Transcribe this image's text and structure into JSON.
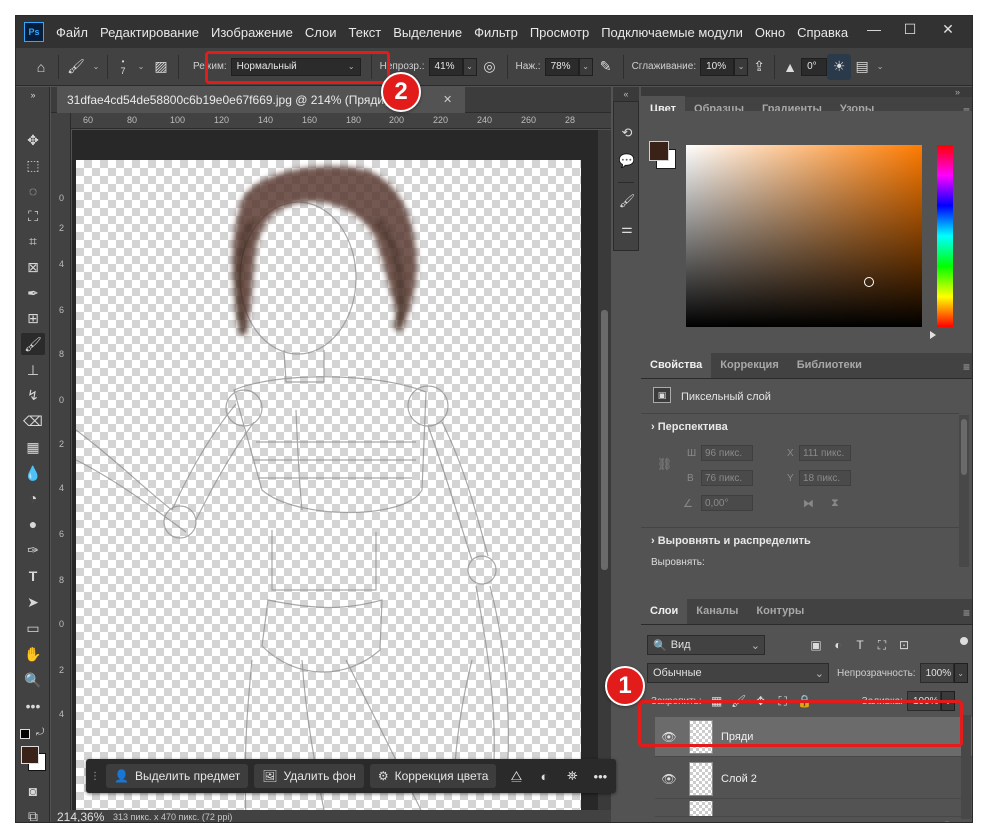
{
  "app": {
    "logo": "Ps"
  },
  "menu": [
    "Файл",
    "Редактирование",
    "Изображение",
    "Слои",
    "Текст",
    "Выделение",
    "Фильтр",
    "Просмотр",
    "Подключаемые модули",
    "Окно",
    "Справка"
  ],
  "window_controls": {
    "minimize": "—",
    "maximize": "☐",
    "close": "✕"
  },
  "options_bar": {
    "brush_size": "7",
    "mode_label": "Режим:",
    "mode_value": "Нормальный",
    "opacity_label": "Непрозр.:",
    "opacity_value": "41%",
    "pressure_label": "Наж.:",
    "pressure_value": "78%",
    "smoothing_label": "Сглаживание:",
    "smoothing_value": "10%",
    "angle_value": "0°"
  },
  "document": {
    "tab_title": "31dfae4cd54de58800c6b19e0e67f669.jpg @ 214% (Пряди, R",
    "close": "✕",
    "ruler_h": [
      "60",
      "80",
      "100",
      "120",
      "140",
      "160",
      "180",
      "200",
      "220",
      "240",
      "260",
      "28"
    ],
    "ruler_v": [
      "0",
      "2",
      "4",
      "6",
      "8",
      "0",
      "2",
      "4",
      "6",
      "8",
      "0",
      "2",
      "4"
    ]
  },
  "task_bar": {
    "select_subject": "Выделить предмет",
    "remove_bg": "Удалить фон",
    "color_correction": "Коррекция цвета",
    "more": "•••"
  },
  "status": {
    "zoom": "214,36%",
    "info": "313 пикс. x 470 пикс. (72 ppi)"
  },
  "color_panel": {
    "tabs": [
      "Цвет",
      "Образцы",
      "Градиенты",
      "Узоры"
    ],
    "foreground": "#3b2219",
    "background": "#ffffff"
  },
  "properties_panel": {
    "tabs": [
      "Свойства",
      "Коррекция",
      "Библиотеки"
    ],
    "layer_type": "Пиксельный слой",
    "perspective_title": "Перспектива",
    "w_label": "Ш",
    "w_value": "96 пикс.",
    "x_label": "X",
    "x_value": "111 пикс.",
    "h_label": "В",
    "h_value": "76 пикс.",
    "y_label": "Y",
    "y_value": "18 пикс.",
    "angle_value": "0,00°",
    "align_title": "Выровнять и распределить",
    "align_label": "Выровнять:"
  },
  "layers_panel": {
    "tabs": [
      "Слои",
      "Каналы",
      "Контуры"
    ],
    "filter_value": "Вид",
    "blend_value": "Обычные",
    "opacity_label": "Непрозрачность:",
    "opacity_value": "100%",
    "lock_label": "Закрепить:",
    "fill_label": "Заливка:",
    "fill_value": "100%",
    "layers": [
      {
        "name": "Пряди",
        "selected": true
      },
      {
        "name": "Слой 2",
        "selected": false
      }
    ]
  },
  "annotations": {
    "step1": "1",
    "step2": "2",
    "accent": "#e21b1b"
  }
}
